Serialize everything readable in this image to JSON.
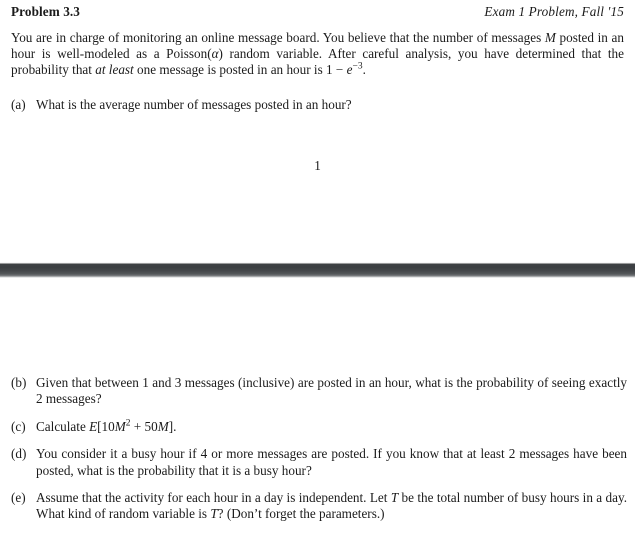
{
  "header": {
    "title": "Problem 3.3",
    "meta": "Exam 1 Problem, Fall '15"
  },
  "intro": {
    "text": "You are in charge of monitoring an online message board. You believe that the number of messages M posted in an hour is well-modeled as a Poisson(α) random variable. After careful analysis, you have determined that the probability that at least one message is posted in an hour is 1 − e⁻³.",
    "segments": {
      "s1": "You are in charge of monitoring an online message board. You believe that the number of messages ",
      "var_m": "M",
      "s2": " posted in an hour is well-modeled as a Poisson(",
      "var_alpha": "α",
      "s3": ") random variable. After careful analysis, you have determined that the probability that ",
      "emph": "at least",
      "s4": " one message is posted in an hour is 1 − ",
      "var_e": "e",
      "exp": "−3",
      "s5": "."
    }
  },
  "page_number": "1",
  "questions_page1": [
    {
      "label": "(a)",
      "text": "What is the average number of messages posted in an hour?"
    }
  ],
  "questions_page2": [
    {
      "label": "(b)",
      "text": "Given that between 1 and 3 messages (inclusive) are posted in an hour, what is the probability of seeing exactly 2 messages?"
    },
    {
      "label": "(c)",
      "prefix": "Calculate ",
      "math_e": "E",
      "math_open": "[10",
      "math_m1": "M",
      "math_sup": "2",
      "math_plus": " + 50",
      "math_m2": "M",
      "math_close": "].",
      "text": "Calculate E[10M2 + 50M]."
    },
    {
      "label": "(d)",
      "text": "You consider it a busy hour if 4 or more messages are posted. If you know that at least 2 messages have been posted, what is the probability that it is a busy hour?"
    },
    {
      "label": "(e)",
      "prefix": "Assume that the activity for each hour in a day is independent. Let ",
      "var_t1": "T",
      "mid": " be the total number of busy hours in a day. What kind of random variable is ",
      "var_t2": "T",
      "suffix": "? (Don’t forget the parameters.)",
      "text": "Assume that the activity for each hour in a day is independent. Let T be the total number of busy hours in a day. What kind of random variable is T? (Don't forget the parameters.)"
    }
  ],
  "divider": {
    "name": "scan-page-break",
    "color": "#3b3e41"
  }
}
